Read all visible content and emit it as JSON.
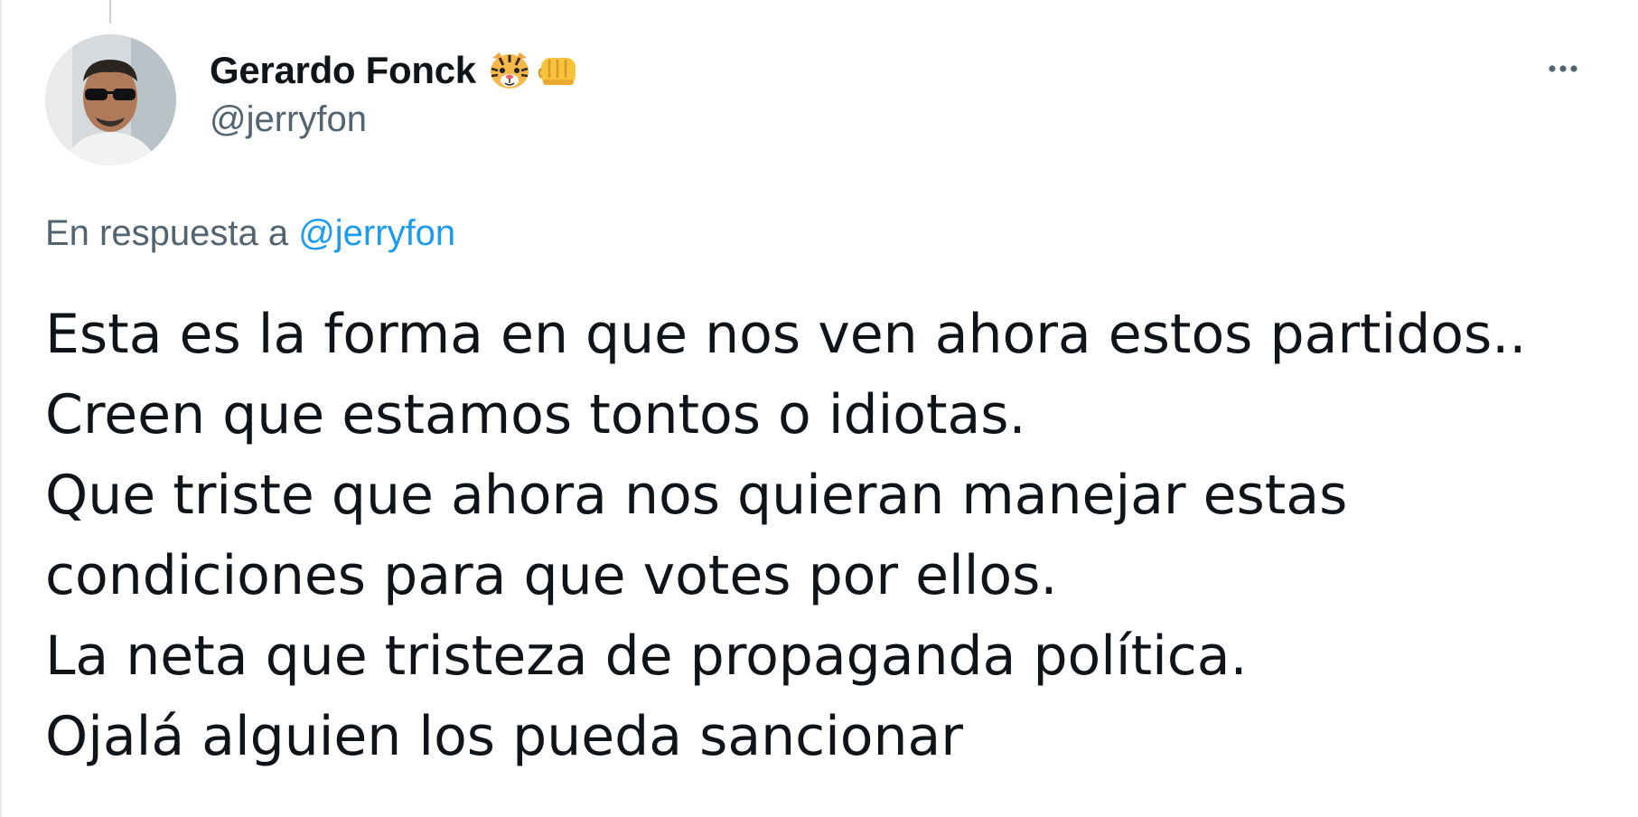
{
  "tweet": {
    "author": {
      "display_name": "Gerardo Fonck",
      "handle": "@jerryfon",
      "name_emojis": [
        "tiger-face-emoji",
        "oncoming-fist-emoji"
      ]
    },
    "reply_context": {
      "prefix": "En respuesta a",
      "mention": "@jerryfon"
    },
    "text_lines": [
      "Esta es la forma en que nos ven ahora estos partidos..",
      "Creen que estamos tontos o idiotas.",
      "Que triste que ahora nos quieran manejar estas",
      "condiciones para que votes por ellos.",
      "La neta que tristeza de propaganda política.",
      "Ojalá alguien los pueda sancionar"
    ],
    "more_icon": "more-horizontal-icon"
  },
  "colors": {
    "text_primary": "#0f1419",
    "text_secondary": "#536471",
    "link": "#1d9bf0",
    "thread_line": "#c4cfd6"
  }
}
